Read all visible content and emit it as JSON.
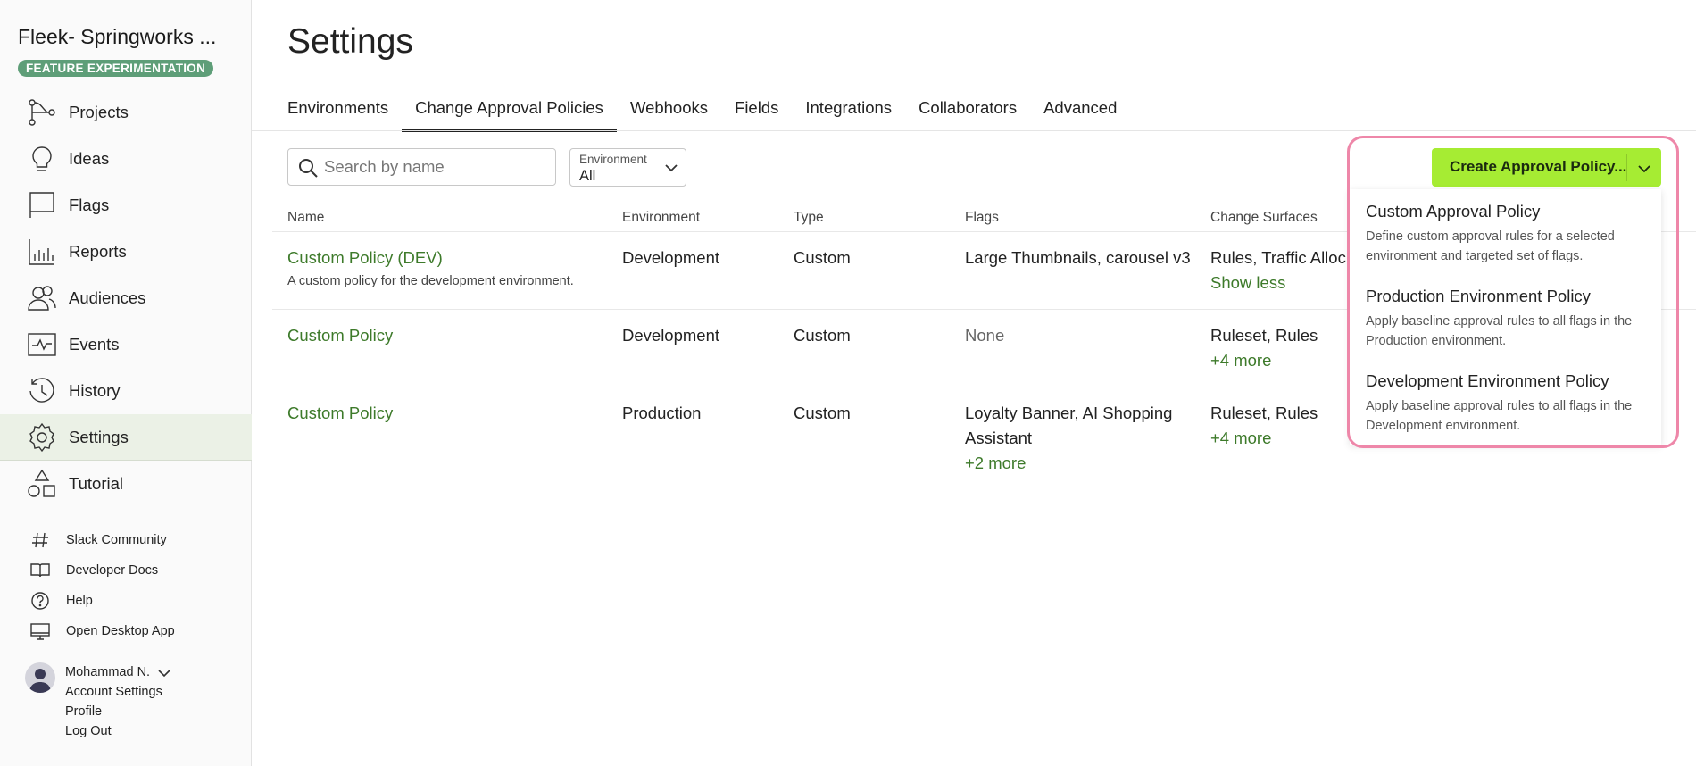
{
  "sidebar": {
    "org_name": "Fleek- Springworks ...",
    "badge": "FEATURE EXPERIMENTATION",
    "nav": [
      {
        "label": "Projects",
        "icon": "projects-icon"
      },
      {
        "label": "Ideas",
        "icon": "lightbulb-icon"
      },
      {
        "label": "Flags",
        "icon": "flag-icon"
      },
      {
        "label": "Reports",
        "icon": "bar-chart-icon"
      },
      {
        "label": "Audiences",
        "icon": "users-icon"
      },
      {
        "label": "Events",
        "icon": "activity-icon"
      },
      {
        "label": "History",
        "icon": "history-icon"
      },
      {
        "label": "Settings",
        "icon": "gear-icon",
        "active": true
      },
      {
        "label": "Tutorial",
        "icon": "shapes-icon"
      }
    ],
    "links": [
      {
        "label": "Slack Community",
        "icon": "hash-icon"
      },
      {
        "label": "Developer Docs",
        "icon": "book-icon"
      },
      {
        "label": "Help",
        "icon": "help-icon"
      },
      {
        "label": "Open Desktop App",
        "icon": "monitor-icon"
      }
    ],
    "user": {
      "name": "Mohammad N.",
      "account_settings": "Account Settings",
      "profile": "Profile",
      "logout": "Log Out"
    }
  },
  "main": {
    "title": "Settings",
    "tabs": [
      {
        "label": "Environments"
      },
      {
        "label": "Change Approval Policies",
        "active": true
      },
      {
        "label": "Webhooks"
      },
      {
        "label": "Fields"
      },
      {
        "label": "Integrations"
      },
      {
        "label": "Collaborators"
      },
      {
        "label": "Advanced"
      }
    ],
    "search": {
      "placeholder": "Search by name",
      "value": ""
    },
    "env_filter": {
      "label": "Environment",
      "value": "All"
    },
    "create_button": "Create Approval Policy...",
    "table": {
      "headers": [
        "Name",
        "Environment",
        "Type",
        "Flags",
        "Change Surfaces"
      ],
      "rows": [
        {
          "name": "Custom Policy (DEV)",
          "description": "A custom policy for the development environment.",
          "environment": "Development",
          "type": "Custom",
          "flags_line1": "Large Thumbnails, carousel v3",
          "flags_line2": "",
          "flags_more": "",
          "surfaces": "Rules, Traffic Alloc",
          "surfaces_more": "Show less"
        },
        {
          "name": "Custom Policy",
          "description": "",
          "environment": "Development",
          "type": "Custom",
          "flags_line1": "None",
          "flags_line2": "",
          "flags_more": "",
          "surfaces": "Ruleset, Rules",
          "surfaces_more": "+4 more"
        },
        {
          "name": "Custom Policy",
          "description": "",
          "environment": "Production",
          "type": "Custom",
          "flags_line1": "Loyalty Banner, AI Shopping",
          "flags_line2": "Assistant",
          "flags_more": "+2 more",
          "surfaces": "Ruleset, Rules",
          "surfaces_more": "+4 more"
        }
      ]
    },
    "menu": [
      {
        "title": "Custom Approval Policy",
        "desc_line1": "Define custom approval rules for a selected",
        "desc_line2": "environment and targeted set of flags."
      },
      {
        "title": "Production Environment Policy",
        "desc_line1": "Apply baseline approval rules to all flags in the",
        "desc_line2": "Production environment."
      },
      {
        "title": "Development Environment Policy",
        "desc_line1": "Apply baseline approval rules to all flags in the",
        "desc_line2": "Development environment."
      }
    ]
  },
  "colors": {
    "accent_green": "#a6ec33",
    "link_green": "#3d7a2a",
    "badge_green": "#5e9e78",
    "highlight_pink": "#ee87a9"
  }
}
